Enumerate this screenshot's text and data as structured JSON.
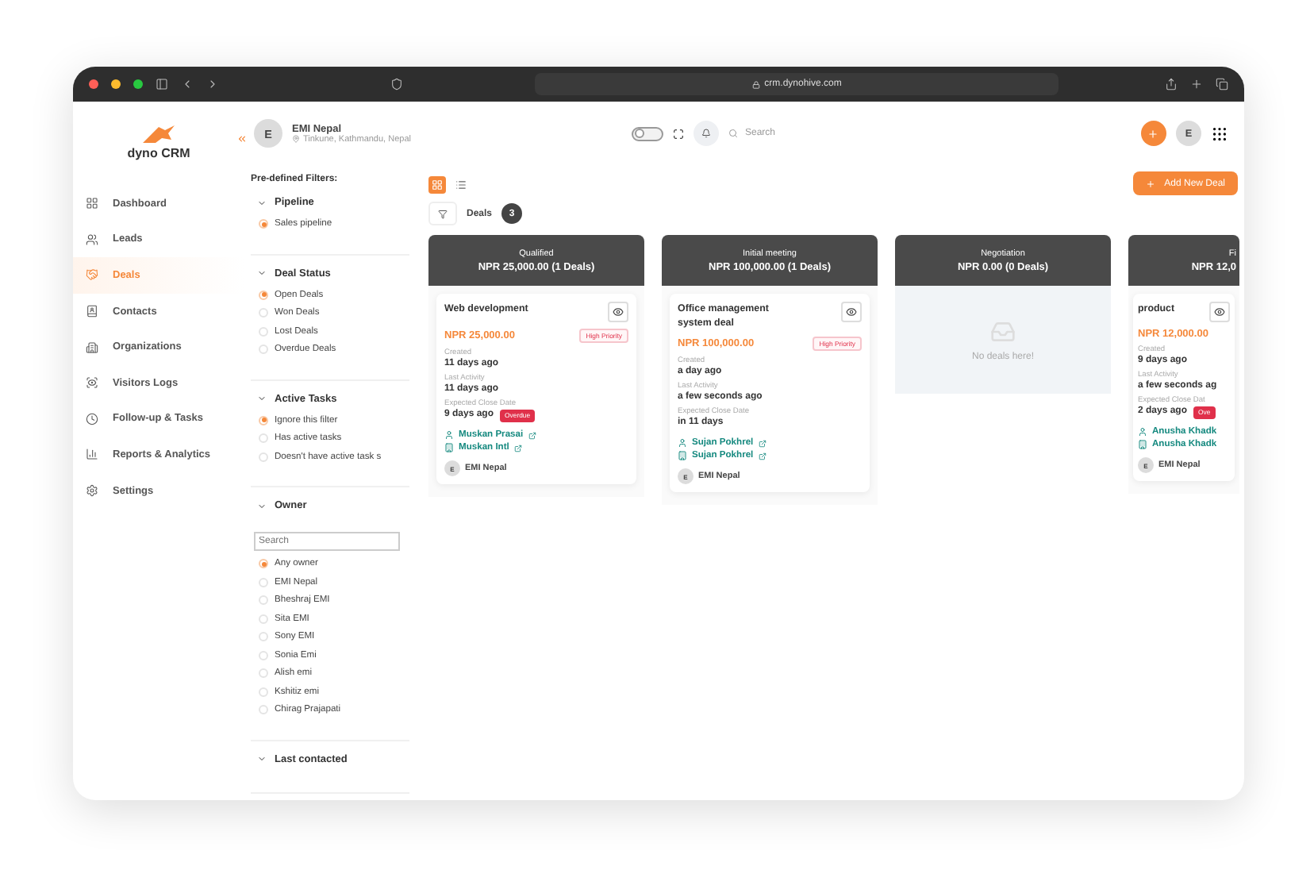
{
  "browser": {
    "url": "crm.dynohive.com"
  },
  "logo": {
    "first": "dyno",
    "second": "CRM"
  },
  "sidebar": {
    "items": [
      {
        "label": "Dashboard",
        "selected": false
      },
      {
        "label": "Leads",
        "selected": false
      },
      {
        "label": "Deals",
        "selected": true
      },
      {
        "label": "Contacts",
        "selected": false
      },
      {
        "label": "Organizations",
        "selected": false
      },
      {
        "label": "Visitors Logs",
        "selected": false
      },
      {
        "label": "Follow-up & Tasks",
        "selected": false
      },
      {
        "label": "Reports & Analytics",
        "selected": false
      },
      {
        "label": "Settings",
        "selected": false
      }
    ]
  },
  "header": {
    "avatar": "E",
    "name": "EMI Nepal",
    "location": "Tinkune, Kathmandu, Nepal",
    "search_placeholder": "Search",
    "user_avatar": "E",
    "theme_toggle": {
      "on": false
    }
  },
  "filters": {
    "title": "Pre-defined Filters:",
    "sections": [
      {
        "title": "Pipeline",
        "options": [
          {
            "label": "Sales pipeline",
            "selected": true
          }
        ]
      },
      {
        "title": "Deal Status",
        "options": [
          {
            "label": "Open Deals",
            "selected": true
          },
          {
            "label": "Won Deals",
            "selected": false
          },
          {
            "label": "Lost Deals",
            "selected": false
          },
          {
            "label": "Overdue Deals",
            "selected": false
          }
        ]
      },
      {
        "title": "Active Tasks",
        "options": [
          {
            "label": "Ignore this filter",
            "selected": true
          },
          {
            "label": "Has active tasks",
            "selected": false
          },
          {
            "label": "Doesn't have active task s",
            "selected": false
          }
        ]
      },
      {
        "title": "Owner",
        "search_placeholder": "Search",
        "options": [
          {
            "label": "Any owner",
            "selected": true
          },
          {
            "label": "EMI Nepal",
            "selected": false
          },
          {
            "label": "Bheshraj EMI",
            "selected": false
          },
          {
            "label": "Sita EMI",
            "selected": false
          },
          {
            "label": "Sony EMI",
            "selected": false
          },
          {
            "label": "Sonia Emi",
            "selected": false
          },
          {
            "label": "Alish emi",
            "selected": false
          },
          {
            "label": "Kshitiz emi",
            "selected": false
          },
          {
            "label": "Chirag Prajapati",
            "selected": false
          }
        ]
      },
      {
        "title": "Last contacted"
      }
    ]
  },
  "toolbar": {
    "views": [
      {
        "kind": "grid",
        "selected": true
      },
      {
        "kind": "list",
        "selected": false
      }
    ],
    "deals_label": "Deals",
    "deals_count": "3",
    "add_button": "Add New Deal"
  },
  "columns": [
    {
      "title": "Qualified",
      "total": "NPR 25,000.00 (1 Deals)",
      "cards": [
        {
          "title": "Web development",
          "amount": "NPR 25,000.00",
          "priority": "High Priority",
          "fields": [
            {
              "label": "Created",
              "value": "11 days ago"
            },
            {
              "label": "Last Activity",
              "value": "11 days ago"
            },
            {
              "label": "Expected Close Date",
              "value": "9 days ago",
              "badge": "Overdue"
            }
          ],
          "contact": "Muskan Prasai",
          "company": "Muskan Intl",
          "owner_initial": "E",
          "owner": "EMI Nepal"
        }
      ]
    },
    {
      "title": "Initial meeting",
      "total": "NPR 100,000.00 (1 Deals)",
      "cards": [
        {
          "title": "Office management system deal",
          "amount": "NPR 100,000.00",
          "priority": "High Priority",
          "fields": [
            {
              "label": "Created",
              "value": "a day ago"
            },
            {
              "label": "Last Activity",
              "value": "a few seconds ago"
            },
            {
              "label": "Expected Close Date",
              "value": "in 11 days"
            }
          ],
          "contact": "Sujan Pokhrel",
          "company": "Sujan Pokhrel",
          "owner_initial": "E",
          "owner": "EMI Nepal"
        }
      ]
    },
    {
      "title": "Negotiation",
      "total": "NPR 0.00 (0 Deals)",
      "empty": "No deals here!"
    },
    {
      "title": "Fi",
      "total": "NPR 12,0",
      "cards": [
        {
          "title": "product",
          "amount": "NPR 12,000.00",
          "fields": [
            {
              "label": "Created",
              "value": "9 days ago"
            },
            {
              "label": "Last Activity",
              "value": "a few seconds ag"
            },
            {
              "label": "Expected Close Dat",
              "value": "2 days ago",
              "badge": "Ove"
            }
          ],
          "contact": "Anusha Khadk",
          "company": "Anusha Khadk",
          "owner_initial": "E",
          "owner": "EMI Nepal"
        }
      ]
    }
  ]
}
